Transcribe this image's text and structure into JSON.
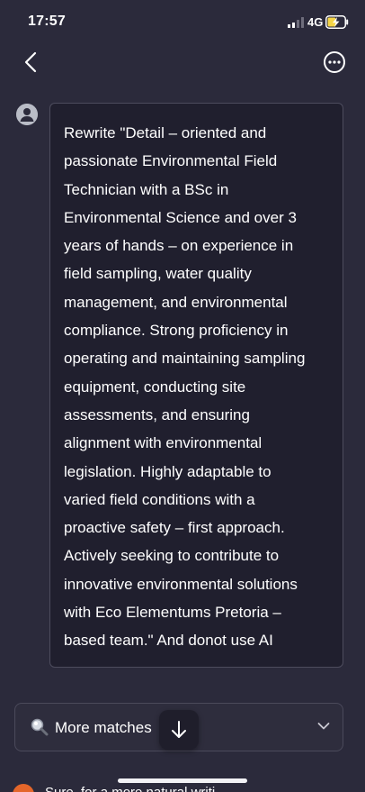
{
  "status_bar": {
    "time": "17:57",
    "network": "4G"
  },
  "message": {
    "text": "Rewrite \"Detail – oriented and\npassionate Environmental Field\nTechnician with a BSc in\nEnvironmental Science and over 3\nyears of hands – on experience in\nfield sampling, water quality\nmanagement, and environmental\ncompliance. Strong proficiency in\noperating and maintaining sampling\nequipment, conducting site\nassessments, and ensuring\nalignment with environmental\nlegislation. Highly adaptable to\nvaried field conditions with a\nproactive safety – first approach.\nActively seeking to contribute to\ninnovative environmental solutions\nwith Eco Elementums Pretoria –\nbased team.\" And donot use AI"
  },
  "more_matches": {
    "label": "More matches"
  },
  "next_item": {
    "text": "Sure, for a more natural writi..."
  },
  "colors": {
    "background": "#2b2a3b",
    "bubble": "#201f2e",
    "accent_orange": "#e4662a"
  }
}
